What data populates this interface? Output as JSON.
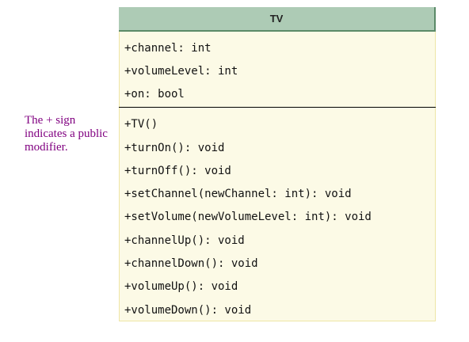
{
  "note": "The + sign indicates a public modifier.",
  "uml_class": {
    "name": "TV",
    "attributes": [
      "+channel: int",
      "+volumeLevel: int",
      "+on: bool"
    ],
    "operations": [
      "+TV()",
      "+turnOn(): void",
      "+turnOff(): void",
      "+setChannel(newChannel: int): void",
      "+setVolume(newVolumeLevel: int): void",
      "+channelUp(): void",
      "+channelDown(): void",
      "+volumeUp(): void",
      "+volumeDown(): void"
    ]
  },
  "colors": {
    "header_fill": "#adcbb5",
    "header_border": "#5b8a68",
    "body_fill": "#fcfae6",
    "note_text": "#800080"
  }
}
